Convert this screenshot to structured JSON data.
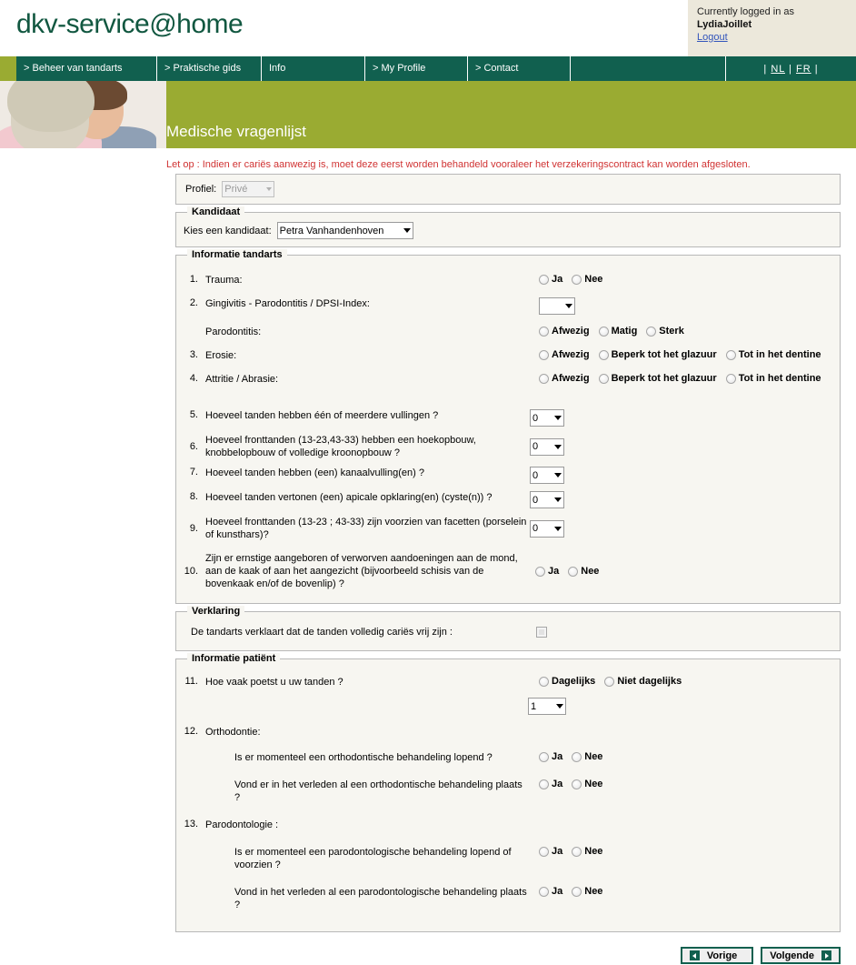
{
  "header": {
    "logo": "dkv-service@home",
    "login_prefix": "Currently logged in as",
    "username": "LydiaJoillet",
    "logout": "Logout"
  },
  "nav": {
    "items": [
      "> Beheer van tandarts",
      "> Praktische gids",
      "Info",
      "> My Profile",
      "> Contact",
      ""
    ],
    "lang_sep_left": "|",
    "lang_nl": "NL",
    "lang_sep_mid": "|",
    "lang_fr": "FR",
    "lang_sep_right": "|"
  },
  "banner": {
    "title": "Medische vragenlijst"
  },
  "warning": "Let op : Indien er cariës aanwezig is, moet deze eerst worden behandeld vooraleer het verzekeringscontract kan worden afgesloten.",
  "profile": {
    "label": "Profiel:",
    "value": "Privé"
  },
  "candidate": {
    "legend": "Kandidaat",
    "label": "Kies een kandidaat:",
    "value": "Petra Vanhandenhoven"
  },
  "dentist_section": {
    "legend": "Informatie tandarts",
    "q1": {
      "num": "1.",
      "text": "Trauma:",
      "opt_ja": "Ja",
      "opt_nee": "Nee"
    },
    "q2": {
      "num": "2.",
      "text": "Gingivitis - Parodontitis / DPSI-Index:",
      "value": ""
    },
    "q2b": {
      "text": "Parodontitis:",
      "opt1": "Afwezig",
      "opt2": "Matig",
      "opt3": "Sterk"
    },
    "q3": {
      "num": "3.",
      "text": "Erosie:",
      "opt1": "Afwezig",
      "opt2": "Beperk tot het glazuur",
      "opt3": "Tot in het dentine"
    },
    "q4": {
      "num": "4.",
      "text": "Attritie / Abrasie:",
      "opt1": "Afwezig",
      "opt2": "Beperk tot het glazuur",
      "opt3": "Tot in het dentine"
    },
    "q5": {
      "num": "5.",
      "text": "Hoeveel tanden hebben één of meerdere vullingen ?",
      "value": "0"
    },
    "q6": {
      "num": "6.",
      "text": "Hoeveel fronttanden (13-23,43-33) hebben een hoekopbouw, knobbelopbouw of volledige kroonopbouw ?",
      "value": "0"
    },
    "q7": {
      "num": "7.",
      "text": "Hoeveel tanden hebben (een) kanaalvulling(en) ?",
      "value": "0"
    },
    "q8": {
      "num": "8.",
      "text": "Hoeveel tanden vertonen (een) apicale opklaring(en) (cyste(n)) ?",
      "value": "0"
    },
    "q9": {
      "num": "9.",
      "text": "Hoeveel fronttanden (13-23 ; 43-33) zijn voorzien van facetten (porselein of kunsthars)?",
      "value": "0"
    },
    "q10": {
      "num": "10.",
      "text": "Zijn er ernstige aangeboren of verworven aandoeningen aan de mond, aan de kaak of aan het aangezicht (bijvoorbeeld schisis van de bovenkaak en/of de bovenlip) ?",
      "opt_ja": "Ja",
      "opt_nee": "Nee"
    }
  },
  "declaration": {
    "legend": "Verklaring",
    "text": "De tandarts verklaart dat de tanden volledig cariës vrij zijn :"
  },
  "patient_section": {
    "legend": "Informatie patiënt",
    "q11": {
      "num": "11.",
      "text": "Hoe vaak poetst u uw tanden ?",
      "opt1": "Dagelijks",
      "opt2": "Niet dagelijks",
      "value": "1"
    },
    "q12": {
      "num": "12.",
      "text": "Orthodontie:"
    },
    "q12a": {
      "text": "Is er momenteel een orthodontische behandeling lopend ?",
      "opt_ja": "Ja",
      "opt_nee": "Nee"
    },
    "q12b": {
      "text": "Vond er in het verleden al een orthodontische behandeling plaats ?",
      "opt_ja": "Ja",
      "opt_nee": "Nee"
    },
    "q13": {
      "num": "13.",
      "text": "Parodontologie :"
    },
    "q13a": {
      "text": "Is er momenteel een parodontologische behandeling lopend of voorzien ?",
      "opt_ja": "Ja",
      "opt_nee": "Nee"
    },
    "q13b": {
      "text": "Vond in het verleden al een parodontologische behandeling plaats ?",
      "opt_ja": "Ja",
      "opt_nee": "Nee"
    }
  },
  "footer": {
    "prev": "Vorige",
    "next": "Volgende"
  },
  "colors": {
    "dark_green": "#11604f",
    "olive": "#9aab32",
    "logo_green": "#115740",
    "beige": "#ece8db",
    "panel_bg": "#f7f6f1",
    "warn_red": "#d03232",
    "link_blue": "#3355bb"
  }
}
